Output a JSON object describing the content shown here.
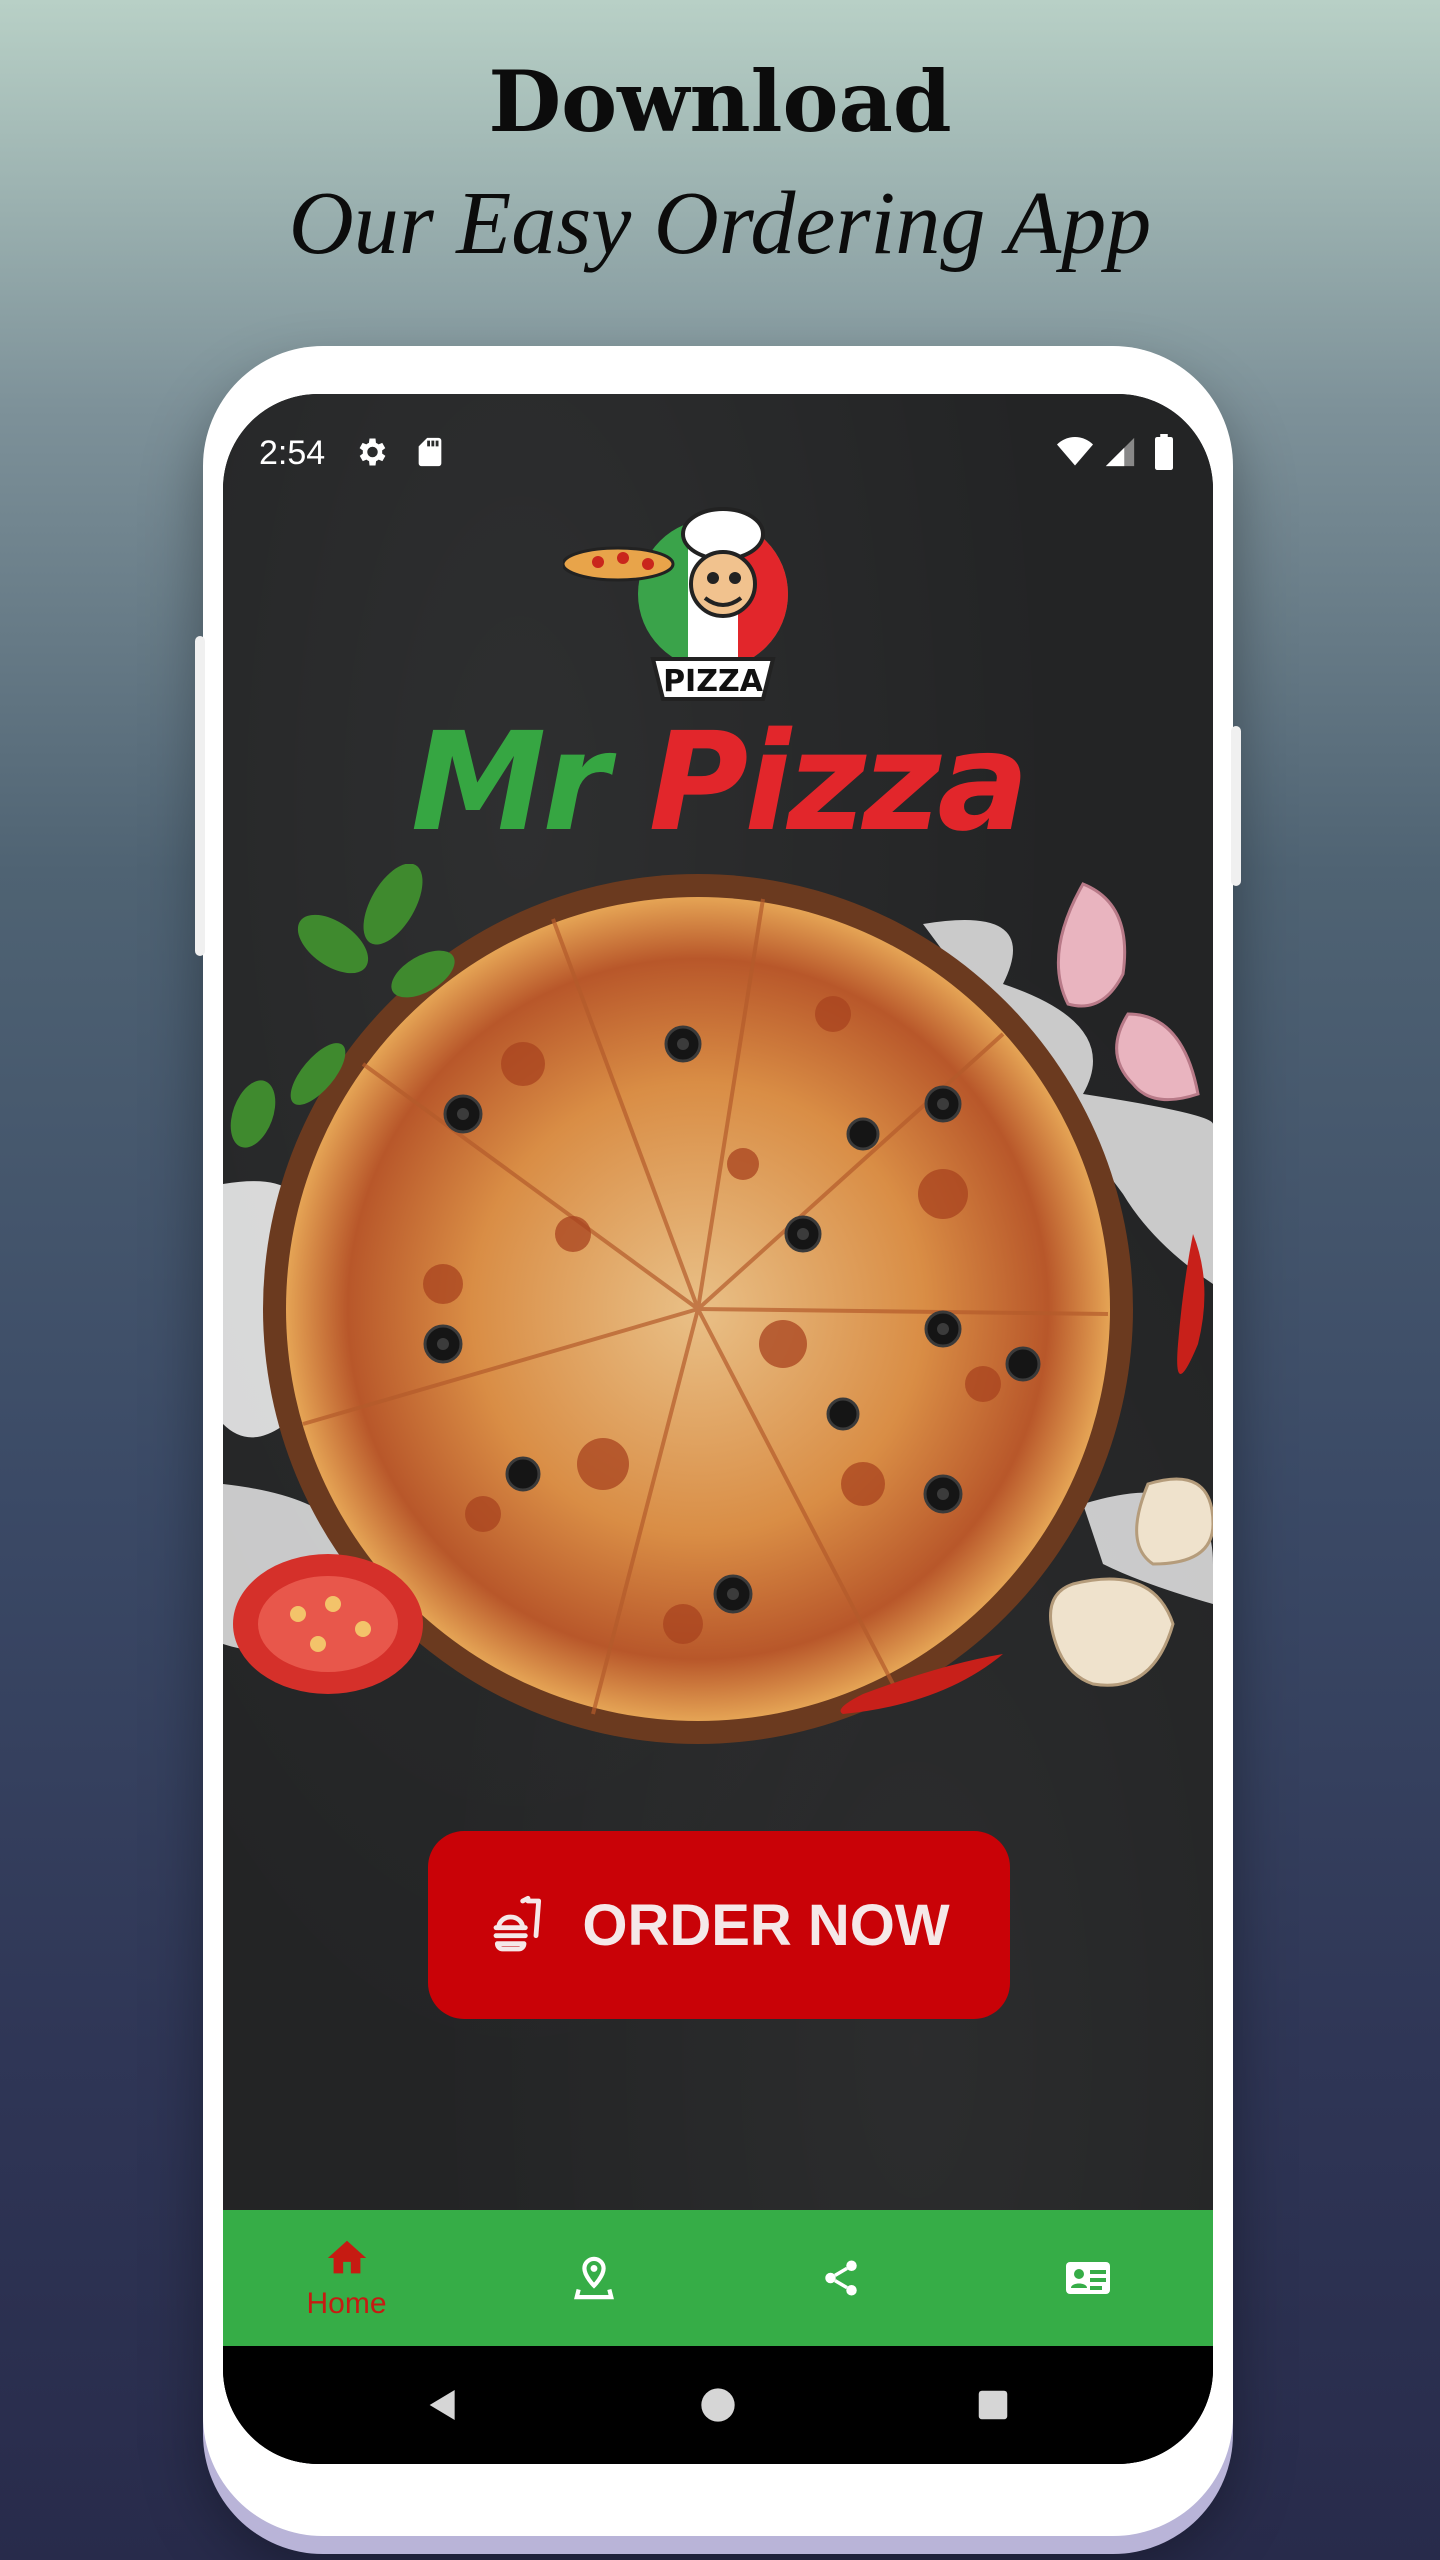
{
  "promo": {
    "headline": "Download",
    "subheadline": "Our Easy Ordering App"
  },
  "status_bar": {
    "time": "2:54",
    "icons": [
      "gear-icon",
      "sd-card-icon",
      "wifi-icon",
      "signal-icon",
      "battery-icon"
    ]
  },
  "app": {
    "logo_badge_text": "PIZZA",
    "brand_first": "Mr",
    "brand_second": "Pizza",
    "order_button": {
      "label": "ORDER NOW",
      "icon": "fast-food-icon"
    }
  },
  "bottom_nav": {
    "items": [
      {
        "label": "Home",
        "icon": "home-icon",
        "active": true
      },
      {
        "label": "",
        "icon": "location-icon",
        "active": false
      },
      {
        "label": "",
        "icon": "share-icon",
        "active": false
      },
      {
        "label": "",
        "icon": "contact-card-icon",
        "active": false
      }
    ]
  },
  "system_nav": [
    "back-icon",
    "home-circle-icon",
    "recents-icon"
  ],
  "colors": {
    "brand_green": "#36a642",
    "brand_red": "#e2262b",
    "button_red": "#c90207",
    "nav_green": "#36ad47",
    "active_nav": "#c61b12"
  }
}
